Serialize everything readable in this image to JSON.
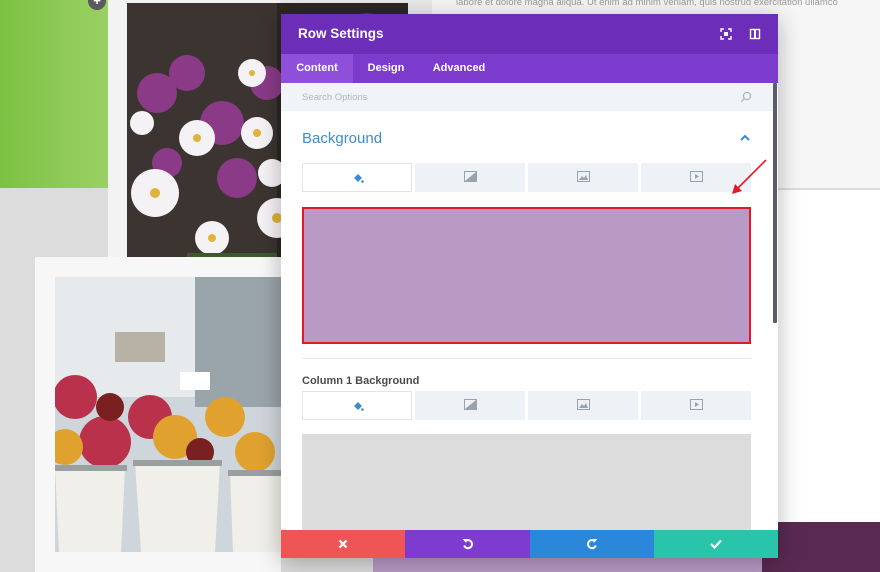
{
  "background_page": {
    "body_text": "labore et dolore magna aliqua. Ut enim ad minim veniam, quis nostrud exercitation ullamco",
    "add_icon": "plus-icon"
  },
  "modal": {
    "title": "Row Settings",
    "header_icons": [
      "fullscreen-icon",
      "sidebar-split-icon"
    ],
    "tabs": [
      {
        "label": "Content",
        "active": true
      },
      {
        "label": "Design",
        "active": false
      },
      {
        "label": "Advanced",
        "active": false
      }
    ],
    "search": {
      "placeholder": "Search Options",
      "icon": "search-icon"
    },
    "background_section": {
      "title": "Background",
      "toggle_icon": "chevron-up-icon",
      "bg_type_tabs": [
        "paint-bucket-icon",
        "gradient-icon",
        "image-icon",
        "video-icon"
      ],
      "active_bg_tab": 0,
      "preview_color": "#b99ac4",
      "highlight_color": "#e0192a"
    },
    "column_background": {
      "label": "Column 1 Background",
      "bg_type_tabs": [
        "paint-bucket-icon",
        "gradient-icon",
        "image-icon",
        "video-icon"
      ],
      "active_bg_tab": 0,
      "preview_color": "#dcdcdc"
    },
    "footer_buttons": [
      {
        "name": "cancel",
        "icon": "close-icon",
        "color": "#ef5555"
      },
      {
        "name": "undo",
        "icon": "undo-icon",
        "color": "#7e3bd0"
      },
      {
        "name": "redo",
        "icon": "redo-icon",
        "color": "#2b87da"
      },
      {
        "name": "save",
        "icon": "check-icon",
        "color": "#29c4a9"
      }
    ]
  },
  "colors": {
    "header": "#6c2eb9",
    "tabs_bar": "#7d3bce",
    "section_title": "#3c8ccf",
    "annotation_arrow": "#e0192a"
  }
}
